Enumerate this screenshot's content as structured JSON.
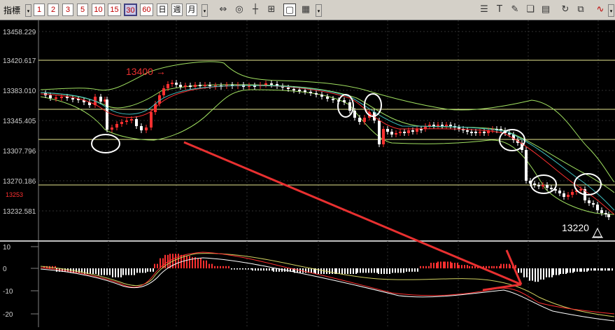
{
  "toolbar": {
    "label": "指標",
    "periods": [
      "1",
      "2",
      "3",
      "5",
      "10",
      "15",
      "30",
      "60"
    ],
    "selected_period": "30",
    "day_label": "日",
    "week_label": "週",
    "month_label": "月",
    "tool_icons_left": [
      "arrows-h-icon",
      "zoom-icon",
      "crosshair-icon",
      "grid-icon",
      "window-icon"
    ],
    "tool_icons_right": [
      "list-icon",
      "text-icon",
      "pen-icon",
      "layers-icon",
      "print-icon",
      "refresh-icon",
      "copy-icon",
      "line-chart-icon"
    ]
  },
  "price_axis": {
    "ticks": [
      "13458.229",
      "13420.617",
      "13383.010",
      "13345.405",
      "13307.796",
      "13270.186",
      "13253",
      "13232.581"
    ],
    "highlight_label": "13253"
  },
  "annotations": {
    "high_label": "13400",
    "high_arrow": "→",
    "low_label": "13220"
  },
  "macd_axis": {
    "ticks": [
      "10",
      "0",
      "-10",
      "-20"
    ]
  },
  "colors": {
    "background": "#000000",
    "up_candle": "#ff3030",
    "down_candle": "#ffffff",
    "grid": "#303030",
    "hline": "#e8e890",
    "bollinger": "#a0e060",
    "ma_red": "#ff3030",
    "ma_cyan": "#40c0c0",
    "annotation": "#e83030"
  }
}
